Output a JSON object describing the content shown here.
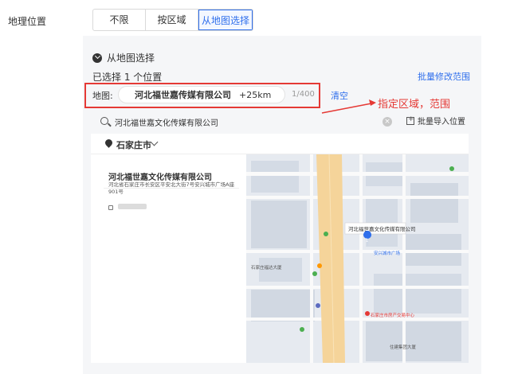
{
  "field_label": "地理位置",
  "location_tabs": [
    {
      "label": "不限",
      "active": false
    },
    {
      "label": "按区域",
      "active": false
    },
    {
      "label": "从地图选择",
      "active": true
    }
  ],
  "map_section": {
    "title": "从地图选择",
    "selected_text": "已选择 1 个位置",
    "batch_edit_label": "批量修改范围",
    "map_label": "地图:",
    "chip_name": "河北福世嘉传媒有限公司",
    "chip_radius": "+25km",
    "count": "1/400",
    "clear_label": "清空",
    "annotation": "指定区域，范围"
  },
  "search": {
    "value": "河北福世嘉文化传媒有限公司",
    "import_label": "批量导入位置"
  },
  "city": "石家庄市",
  "result": {
    "name": "河北福世嘉文化传媒有限公司",
    "address": "河北省石家庄市长安区平安北大街7号安兴城市广场A座901号"
  },
  "map_labels": {
    "place": "河北福世嘉文化传媒有限公司",
    "marker": "1",
    "poi1": "安兴城市广场",
    "poi2": "石家庄市房产交易中心",
    "poi3": "住建集团大厦",
    "poi4": "石家庄福达大厦"
  },
  "colors": {
    "accent": "#2f6fec",
    "annotation": "#e53935",
    "road": "#f5d49a"
  }
}
